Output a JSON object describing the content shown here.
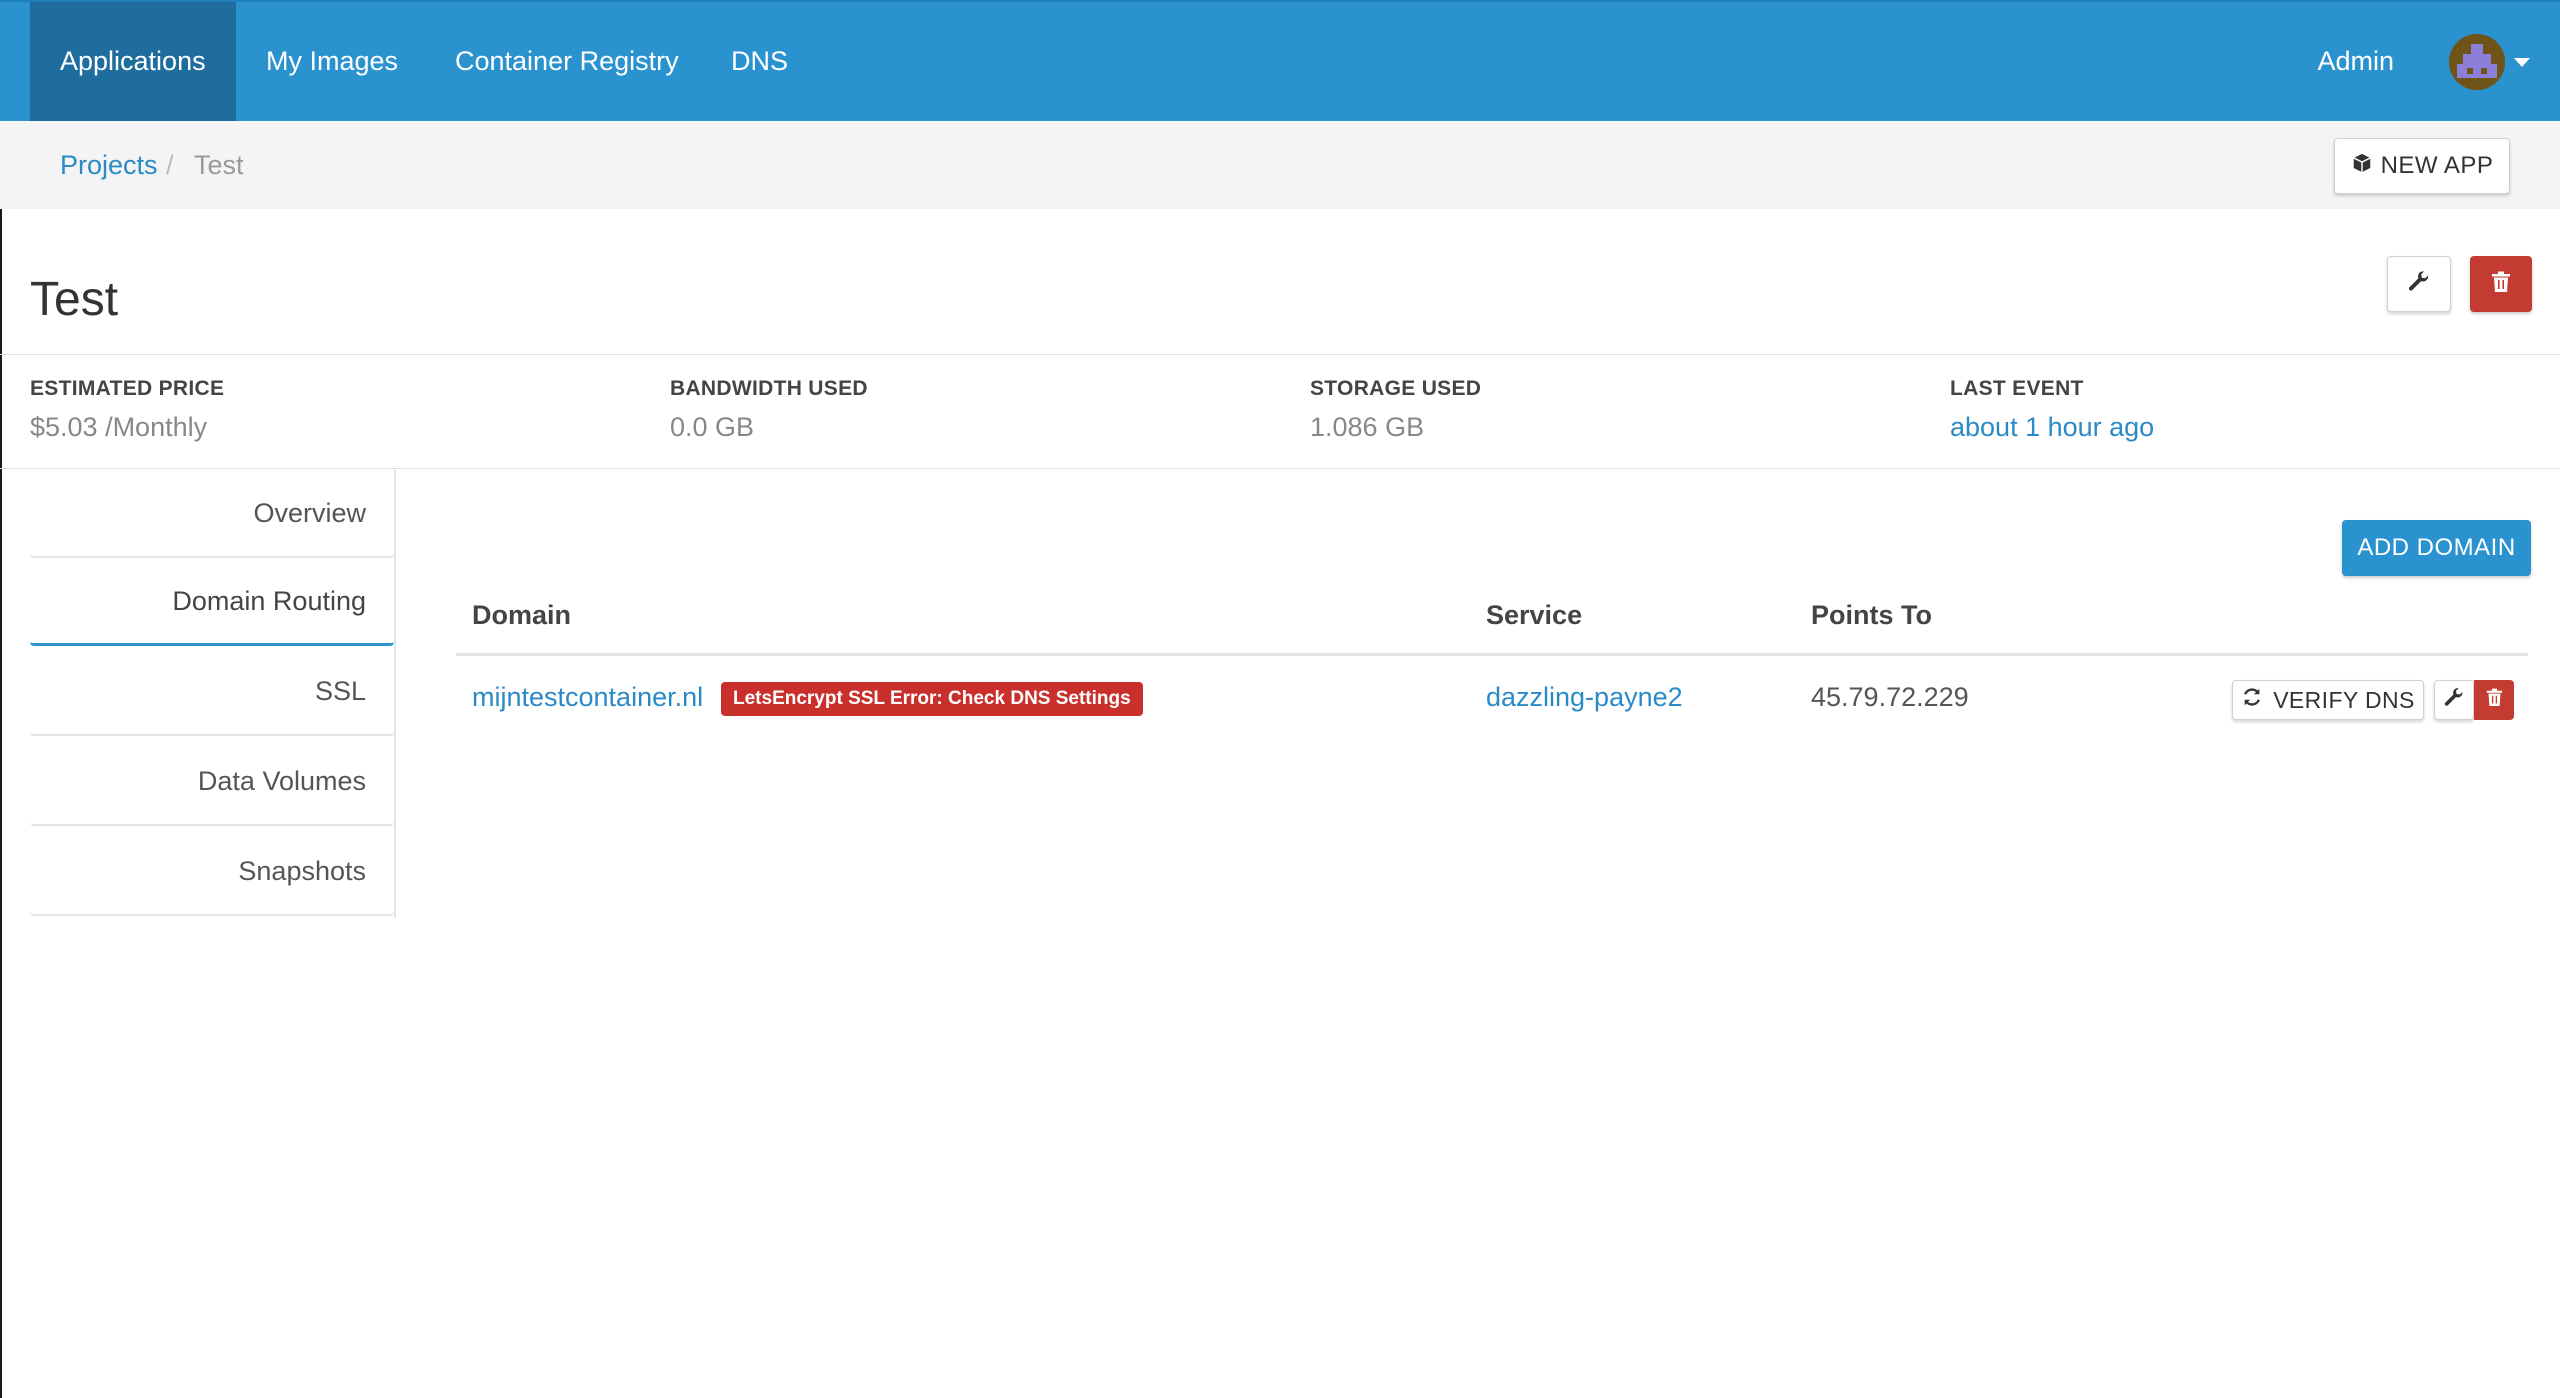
{
  "nav": {
    "items": [
      {
        "label": "Applications",
        "active": true
      },
      {
        "label": "My Images",
        "active": false
      },
      {
        "label": "Container Registry",
        "active": false
      },
      {
        "label": "DNS",
        "active": false
      }
    ],
    "admin_label": "Admin",
    "avatar_icon": "user-avatar-icon",
    "colors": {
      "nav_bg": "#2a93cf",
      "nav_active": "#1f6d9f"
    }
  },
  "breadcrumb": {
    "root": "Projects",
    "separator": "/",
    "current": "Test"
  },
  "toolbar": {
    "new_app_label": "NEW APP",
    "new_app_icon": "cube-icon"
  },
  "page": {
    "title": "Test",
    "edit_icon": "wrench-icon",
    "delete_icon": "trash-icon",
    "danger_color": "#c33b31"
  },
  "stats": [
    {
      "label": "ESTIMATED PRICE",
      "value": "$5.03 /Monthly",
      "link": false
    },
    {
      "label": "BANDWIDTH USED",
      "value": "0.0 GB",
      "link": false
    },
    {
      "label": "STORAGE USED",
      "value": "1.086 GB",
      "link": false
    },
    {
      "label": "LAST EVENT",
      "value": "about 1 hour ago",
      "link": true
    }
  ],
  "side_tabs": [
    {
      "label": "Overview",
      "active": false
    },
    {
      "label": "Domain Routing",
      "active": true
    },
    {
      "label": "SSL",
      "active": false
    },
    {
      "label": "Data Volumes",
      "active": false
    },
    {
      "label": "Snapshots",
      "active": false
    }
  ],
  "domains": {
    "add_label": "ADD DOMAIN",
    "headers": [
      "Domain",
      "Service",
      "Points To"
    ],
    "rows": [
      {
        "domain": "mijntestcontainer.nl",
        "badge": "LetsEncrypt SSL Error: Check DNS Settings",
        "service": "dazzling-payne2",
        "points_to": "45.79.72.229",
        "verify_label": "VERIFY DNS"
      }
    ]
  }
}
